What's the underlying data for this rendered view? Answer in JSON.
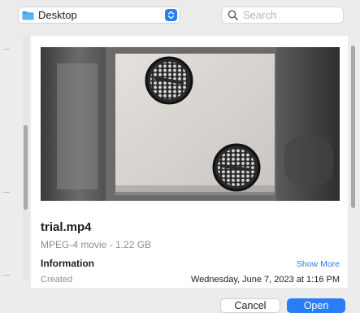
{
  "location": {
    "label": "Desktop",
    "icon": "folder-icon"
  },
  "search": {
    "placeholder": "Search",
    "value": "",
    "icon": "search-icon"
  },
  "preview": {
    "file_name": "trial.mp4",
    "file_kind": "MPEG-4 movie - 1.22 GB",
    "info_heading": "Information",
    "show_more": "Show More",
    "created_label": "Created",
    "created_value": "Wednesday, June 7, 2023 at 1:16 PM"
  },
  "buttons": {
    "cancel": "Cancel",
    "open": "Open"
  },
  "colors": {
    "accent": "#2a7ef5",
    "window_bg": "#ececec",
    "panel_bg": "#ffffff",
    "secondary_text": "#8e8e93"
  }
}
